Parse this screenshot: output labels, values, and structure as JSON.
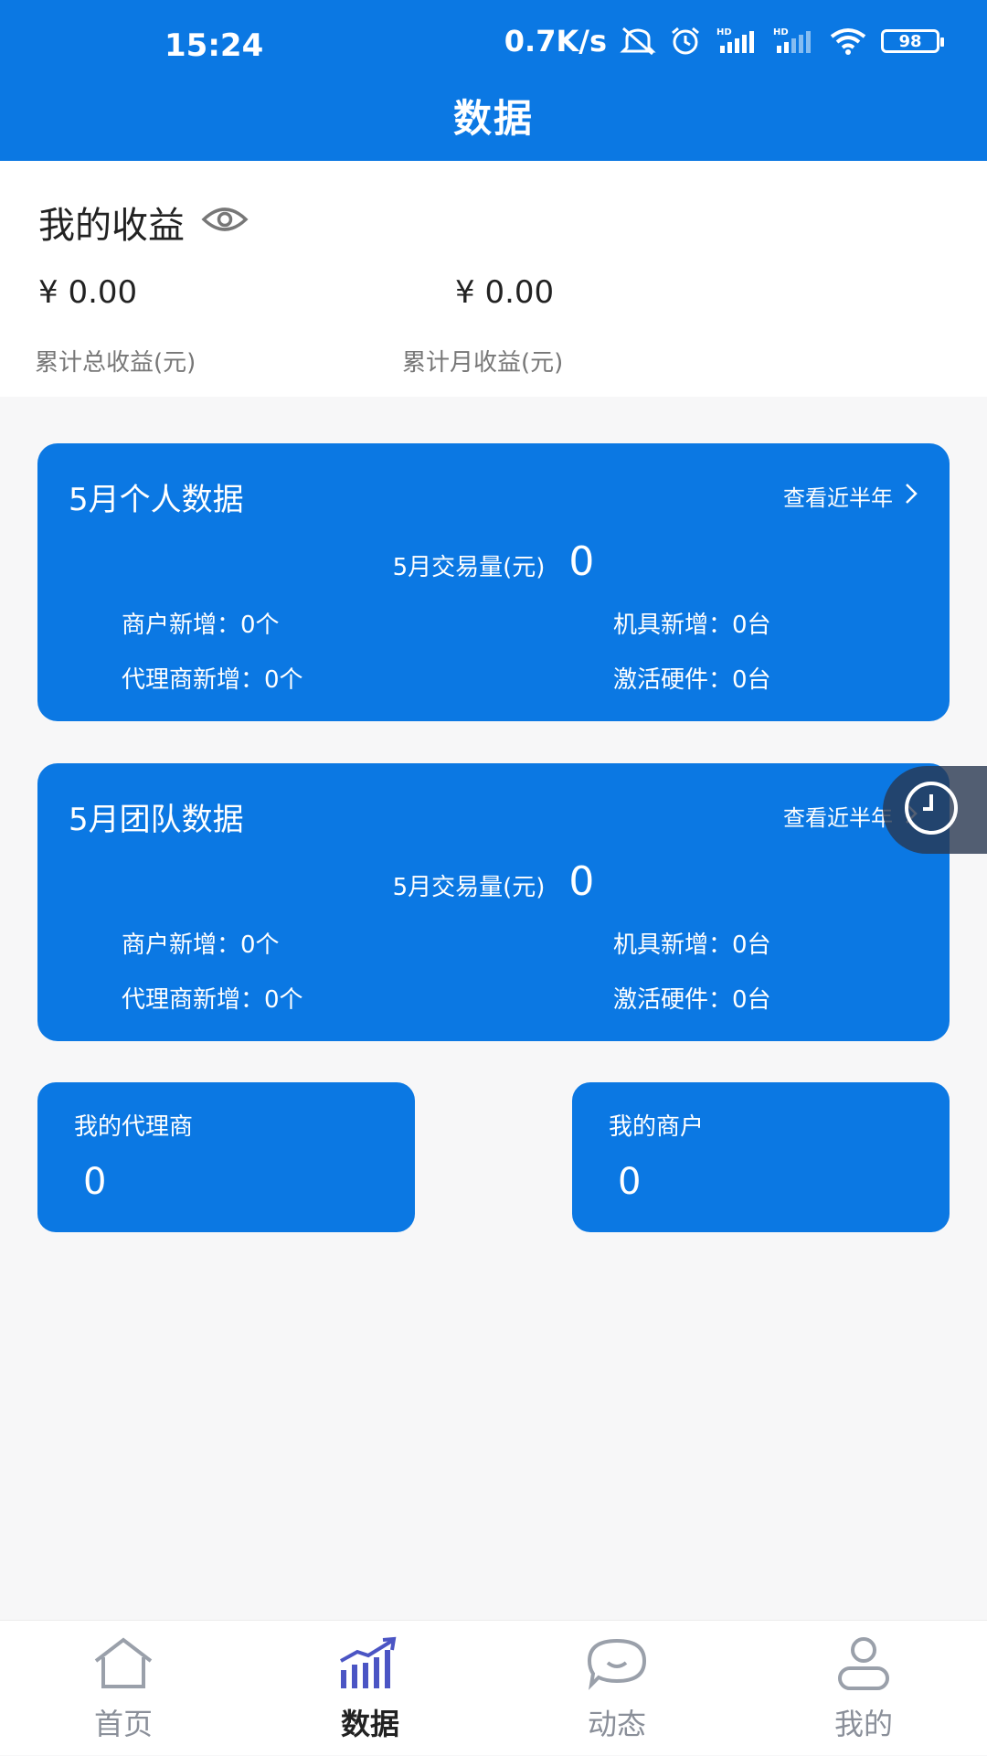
{
  "status_bar": {
    "time": "15:24",
    "network_speed": "0.7K/s",
    "battery": "98",
    "hd1": "HD",
    "hd2": "HD"
  },
  "header": {
    "title": "数据"
  },
  "earnings": {
    "title": "我的收益",
    "total_value": "¥ 0.00",
    "total_label": "累计总收益(元)",
    "month_value": "¥ 0.00",
    "month_label": "累计月收益(元)"
  },
  "personal": {
    "title": "5月个人数据",
    "link": "查看近半年",
    "volume_label": "5月交易量(元)",
    "volume_value": "0",
    "merchant_new": "商户新增：0个",
    "machine_new": "机具新增：0台",
    "agent_new": "代理商新增：0个",
    "hardware_activated": "激活硬件：0台"
  },
  "team": {
    "title": "5月团队数据",
    "link": "查看近半年",
    "volume_label": "5月交易量(元)",
    "volume_value": "0",
    "merchant_new": "商户新增：0个",
    "machine_new": "机具新增：0台",
    "agent_new": "代理商新增：0个",
    "hardware_activated": "激活硬件：0台"
  },
  "my_agents": {
    "title": "我的代理商",
    "value": "0"
  },
  "my_merchants": {
    "title": "我的商户",
    "value": "0"
  },
  "nav": {
    "home": "首页",
    "data": "数据",
    "dynamics": "动态",
    "mine": "我的"
  },
  "colors": {
    "primary": "#0b78e3",
    "nav_active_icon": "#4b55c4"
  }
}
